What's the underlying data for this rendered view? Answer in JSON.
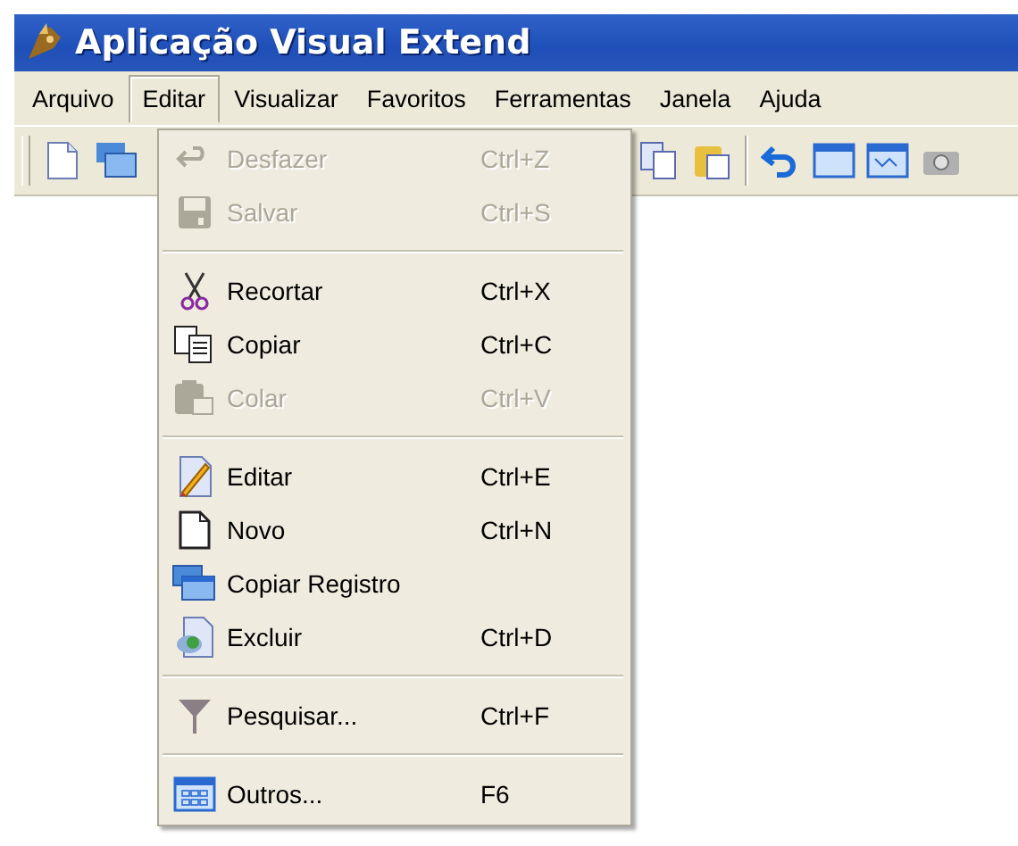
{
  "window": {
    "title": "Aplicação Visual Extend"
  },
  "menu_bar": [
    {
      "label": "Arquivo",
      "selected": false
    },
    {
      "label": "Editar",
      "selected": true
    },
    {
      "label": "Visualizar",
      "selected": false
    },
    {
      "label": "Favoritos",
      "selected": false
    },
    {
      "label": "Ferramentas",
      "selected": false
    },
    {
      "label": "Janela",
      "selected": false
    },
    {
      "label": "Ajuda",
      "selected": false
    }
  ],
  "edit_menu": [
    {
      "kind": "item",
      "label": "Desfazer",
      "shortcut": "Ctrl+Z",
      "disabled": true
    },
    {
      "kind": "item",
      "label": "Salvar",
      "shortcut": "Ctrl+S",
      "disabled": true
    },
    {
      "kind": "separator"
    },
    {
      "kind": "item",
      "label": "Recortar",
      "shortcut": "Ctrl+X",
      "disabled": false
    },
    {
      "kind": "item",
      "label": "Copiar",
      "shortcut": "Ctrl+C",
      "disabled": false
    },
    {
      "kind": "item",
      "label": "Colar",
      "shortcut": "Ctrl+V",
      "disabled": true
    },
    {
      "kind": "separator"
    },
    {
      "kind": "item",
      "label": "Editar",
      "shortcut": "Ctrl+E",
      "disabled": false
    },
    {
      "kind": "item",
      "label": "Novo",
      "shortcut": "Ctrl+N",
      "disabled": false
    },
    {
      "kind": "item",
      "label": "Copiar Registro",
      "disabled": false
    },
    {
      "kind": "item",
      "label": "Excluir",
      "shortcut": "Ctrl+D",
      "disabled": false
    },
    {
      "kind": "separator"
    },
    {
      "kind": "item",
      "label": "Pesquisar...",
      "shortcut": "Ctrl+F",
      "disabled": false
    },
    {
      "kind": "separator"
    },
    {
      "kind": "item",
      "label": "Outros...",
      "shortcut": "F6",
      "disabled": false
    }
  ]
}
